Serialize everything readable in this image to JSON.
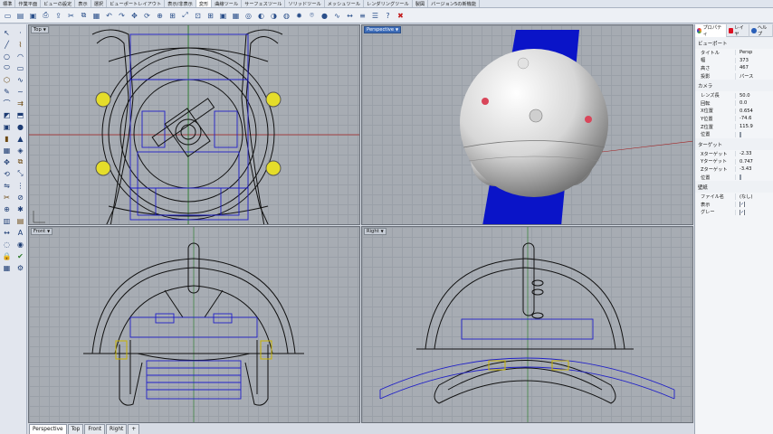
{
  "menu_tabs": [
    "標準",
    "作業平面",
    "ビューの設定",
    "表示",
    "選択",
    "ビューポートレイアウト",
    "表示/非表示",
    "変形",
    "曲線ツール",
    "サーフェスツール",
    "ソリッドツール",
    "メッシュツール",
    "レンダリングツール",
    "製図",
    "バージョン5の新機能"
  ],
  "menu_active_index": 7,
  "toolbar_icons": [
    "new-file-icon",
    "open-file-icon",
    "save-icon",
    "print-icon",
    "import-icon",
    "cut-icon",
    "copy-icon",
    "paste-icon",
    "undo-icon",
    "redo-icon",
    "pan-icon",
    "rotate-view-icon",
    "zoom-icon",
    "zoom-window-icon",
    "zoom-extents-icon",
    "zoom-selected-icon",
    "four-viewports-icon",
    "select-all-icon",
    "grid-icon",
    "osnap-icon",
    "render-icon",
    "shade-icon",
    "material-icon",
    "light-icon",
    "camera-icon",
    "shaded-sphere-icon",
    "curve-icon",
    "dimension-icon",
    "layers-icon",
    "properties-icon",
    "help-icon",
    "stop-icon"
  ],
  "viewports": {
    "top": {
      "label": "Top"
    },
    "perspective": {
      "label": "Perspective"
    },
    "front": {
      "label": "Front"
    },
    "right": {
      "label": "Right"
    }
  },
  "bottom_tabs": [
    "Perspective",
    "Top",
    "Front",
    "Right",
    "+"
  ],
  "panel": {
    "tabs": [
      "プロパティ",
      "レイヤ",
      "ヘルプ"
    ],
    "viewport_section": "ビューポート",
    "viewport_rows": [
      {
        "k": "タイトル",
        "v": "Persp"
      },
      {
        "k": "幅",
        "v": "373"
      },
      {
        "k": "高さ",
        "v": "467"
      },
      {
        "k": "投影",
        "v": "パース"
      }
    ],
    "camera_section": "カメラ",
    "camera_rows": [
      {
        "k": "レンズ長",
        "v": "50.0"
      },
      {
        "k": "回転",
        "v": "0.0"
      },
      {
        "k": "X位置",
        "v": "0.654"
      },
      {
        "k": "Y位置",
        "v": "-74.6"
      },
      {
        "k": "Z位置",
        "v": "115.9"
      },
      {
        "k": "位置",
        "v": ""
      }
    ],
    "target_section": "ターゲット",
    "target_rows": [
      {
        "k": "Xターゲット",
        "v": "-2.33"
      },
      {
        "k": "Yターゲット",
        "v": "0.747"
      },
      {
        "k": "Zターゲット",
        "v": "-3.43"
      },
      {
        "k": "位置",
        "v": ""
      }
    ],
    "wallpaper_section": "壁紙",
    "wallpaper_rows": [
      {
        "k": "ファイル名",
        "v": "(なし)"
      },
      {
        "k": "表示",
        "v": "✓"
      },
      {
        "k": "グレー",
        "v": "✓"
      }
    ]
  }
}
